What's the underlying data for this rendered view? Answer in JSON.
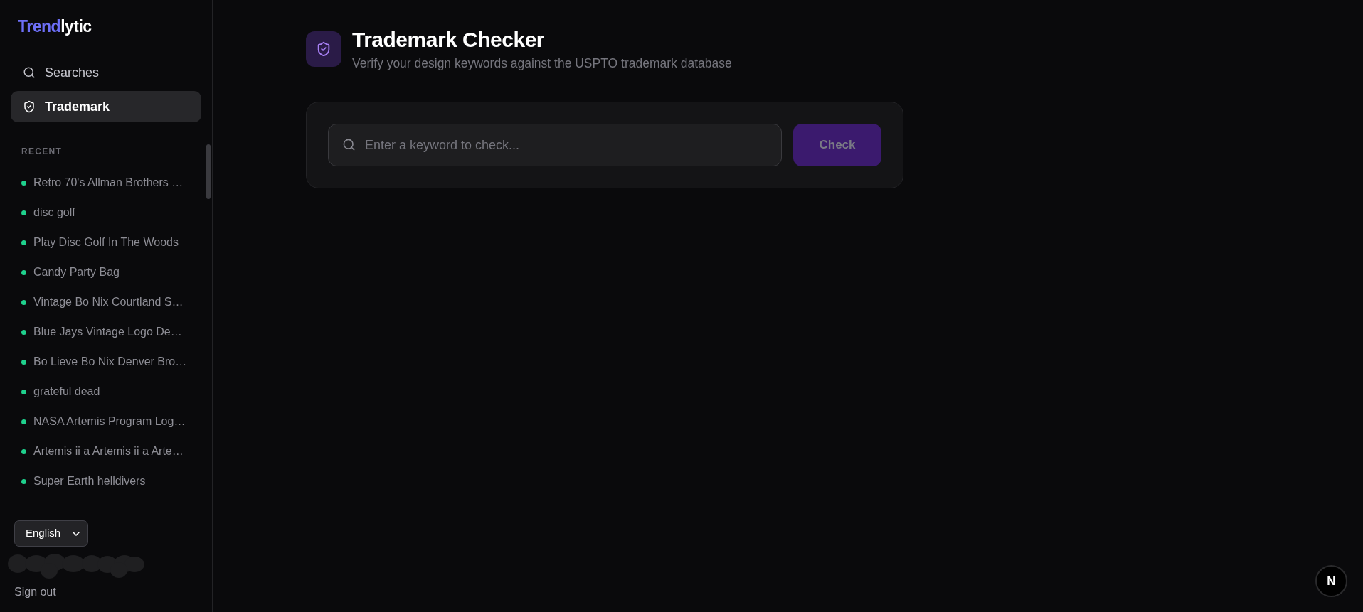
{
  "sidebar": {
    "logo": {
      "accent": "Trend",
      "rest": "lytic"
    },
    "nav": [
      {
        "label": "Searches",
        "selected": false
      },
      {
        "label": "Trademark",
        "selected": true
      }
    ],
    "recent": {
      "heading": "RECENT",
      "items": [
        {
          "label": "Retro 70's Allman Brothers …"
        },
        {
          "label": "disc golf"
        },
        {
          "label": "Play Disc Golf In The Woods"
        },
        {
          "label": "Candy Party Bag"
        },
        {
          "label": "Vintage Bo Nix Courtland S…"
        },
        {
          "label": "Blue Jays Vintage Logo De…"
        },
        {
          "label": "Bo Lieve Bo Nix Denver Bro…"
        },
        {
          "label": "grateful dead"
        },
        {
          "label": "NASA Artemis Program Log…"
        },
        {
          "label": "Artemis ii a Artemis ii a Arte…"
        },
        {
          "label": "Super Earth helldivers"
        }
      ]
    },
    "language_select": {
      "value": "English"
    },
    "sign_out": "Sign out"
  },
  "header": {
    "title": "Trademark Checker",
    "subtitle": "Verify your design keywords against the USPTO trademark database"
  },
  "search_card": {
    "input": {
      "placeholder": "Enter a keyword to check..."
    },
    "button": {
      "label": "Check",
      "disabled": true
    }
  },
  "dev_badge": {
    "label": "N"
  }
}
